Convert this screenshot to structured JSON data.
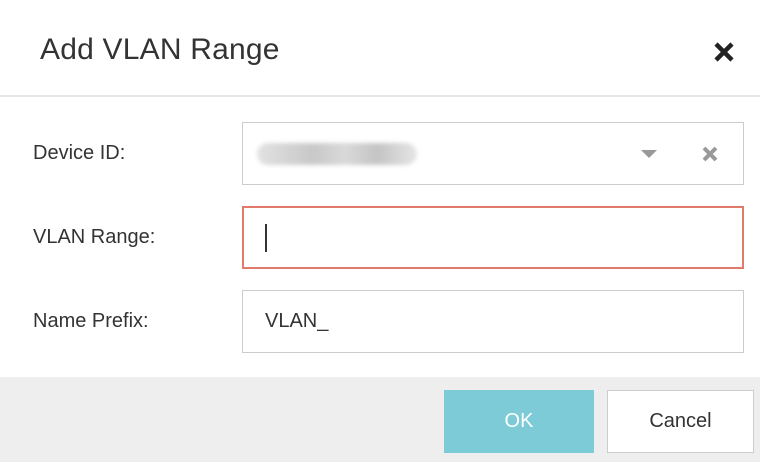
{
  "dialog": {
    "title": "Add VLAN Range",
    "close_icon": "close-icon"
  },
  "form": {
    "device_id": {
      "label": "Device ID:",
      "value_blurred": true,
      "dropdown_icon": "caret-down-icon",
      "clear_icon": "clear-icon"
    },
    "vlan_range": {
      "label": "VLAN Range:",
      "value": "",
      "state": "error",
      "error_border_color": "#e07a6a"
    },
    "name_prefix": {
      "label": "Name Prefix:",
      "value": "VLAN_"
    }
  },
  "footer": {
    "ok_label": "OK",
    "cancel_label": "Cancel",
    "ok_color": "#7ccbd6"
  }
}
